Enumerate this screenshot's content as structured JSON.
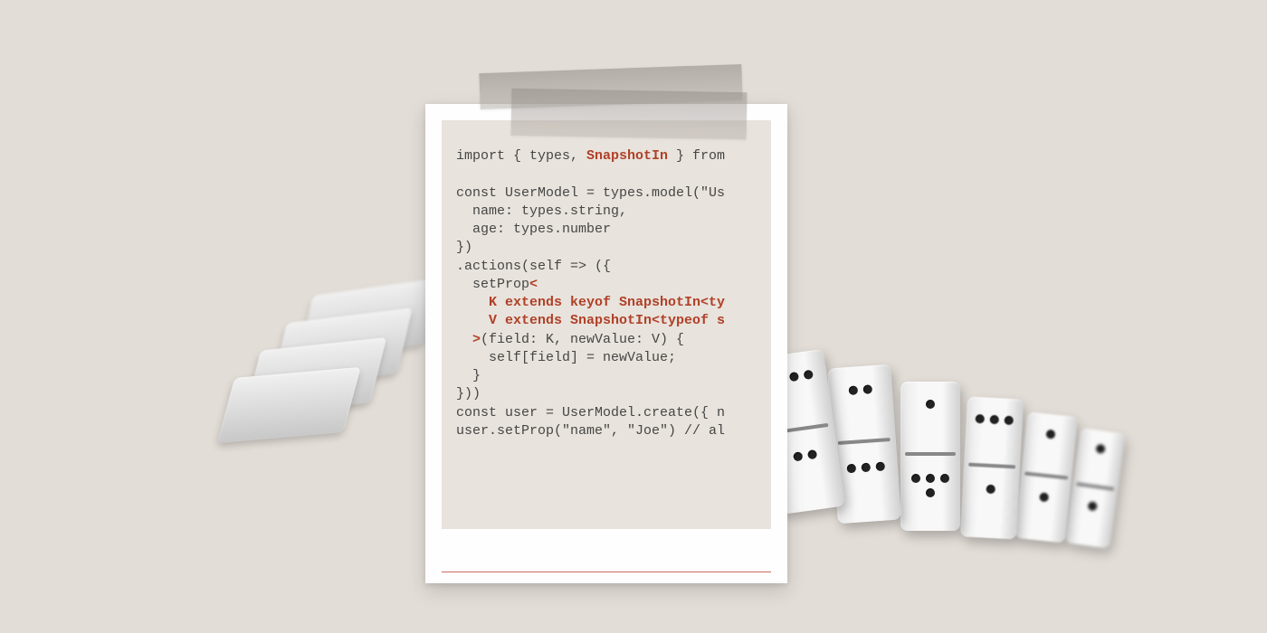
{
  "code": {
    "l1a": "import { types, ",
    "l1b": "SnapshotIn",
    "l1c": " } from",
    "l2": "",
    "l3": "const UserModel = types.model(\"Us",
    "l4": "  name: types.string,",
    "l5": "  age: types.number",
    "l6": "})",
    "l7": ".actions(self => ({",
    "l8a": "  setProp",
    "l8b": "<",
    "l9": "    K extends keyof SnapshotIn<ty",
    "l10": "    V extends SnapshotIn<typeof s",
    "l11a": "  >",
    "l11b": "(field: K, newValue: V) {",
    "l12": "    self[field] = newValue;",
    "l13": "  }",
    "l14": "}))",
    "l15": "const user = UserModel.create({ n",
    "l16": "user.setProp(\"name\", \"Joe\") // al"
  }
}
